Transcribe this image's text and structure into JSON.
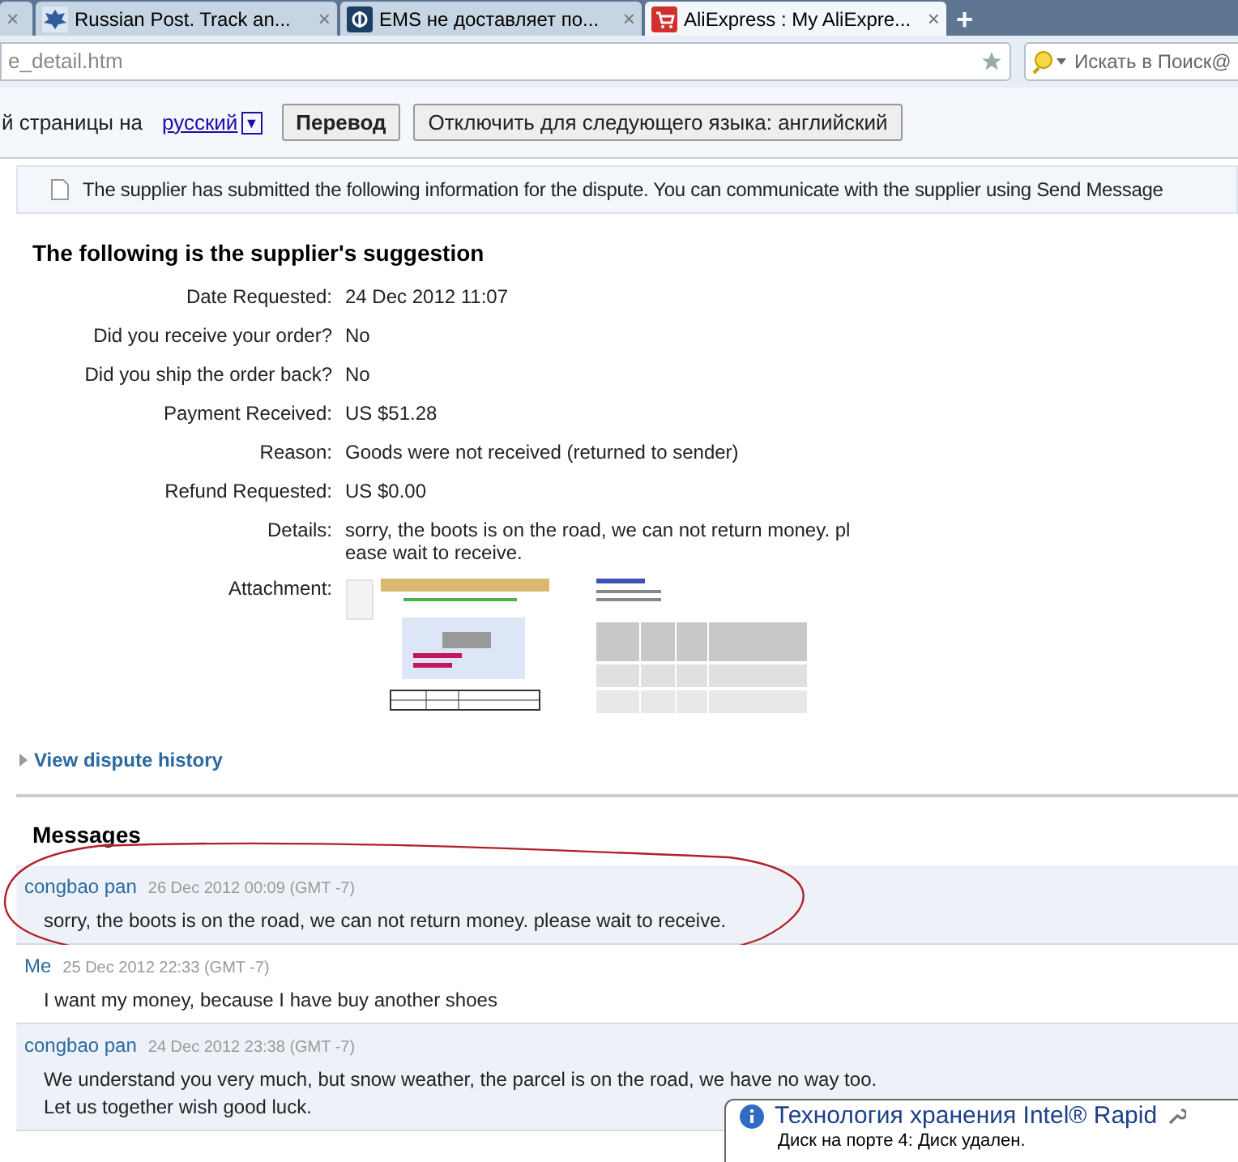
{
  "browser": {
    "tabs": [
      {
        "close": "×",
        "selected": false,
        "kind": "partial"
      },
      {
        "title": "Russian Post. Track an...",
        "close": "×",
        "selected": false,
        "kind": "post"
      },
      {
        "title": "EMS не доставляет по...",
        "close": "×",
        "selected": false,
        "kind": "ems"
      },
      {
        "title": "AliExpress : My AliExpre...",
        "close": "×",
        "selected": true,
        "kind": "cart"
      }
    ],
    "new_tab": "+",
    "address": "e_detail.htm",
    "search_placeholder": "Искать в Поиск@"
  },
  "translate_bar": {
    "prefix": "й страницы на",
    "language": "русский",
    "dropdown": "▼",
    "translate_button": "Перевод",
    "disable_button": "Отключить для следующего языка: английский"
  },
  "notice": "The supplier has submitted the following information for the dispute. You can communicate with the supplier using Send Message",
  "suggestion": {
    "title": "The following is the supplier's suggestion",
    "fields": [
      {
        "label": "Date Requested:",
        "value": "24 Dec 2012 11:07"
      },
      {
        "label": "Did you receive your order?",
        "value": "No"
      },
      {
        "label": "Did you ship the order back?",
        "value": "No"
      },
      {
        "label": "Payment Received:",
        "value": "US $51.28"
      },
      {
        "label": "Reason:",
        "value": "Goods were not received (returned to sender)"
      },
      {
        "label": "Refund Requested:",
        "value": "US $0.00"
      },
      {
        "label": "Details:",
        "value": "sorry, the boots is on the road, we can not return money. pl\nease wait to receive."
      }
    ],
    "attachment_label": "Attachment:",
    "attachments": [
      {
        "kind": "form"
      },
      {
        "kind": "table"
      }
    ]
  },
  "history_link": "View dispute history",
  "messages_title": "Messages",
  "messages": [
    {
      "author": "congbao pan",
      "date": "26 Dec 2012 00:09 (GMT -7)",
      "text": "sorry, the boots is on the road, we can not return money. please wait to receive.",
      "shaded": true,
      "circled": true
    },
    {
      "author": "Me",
      "date": "25 Dec 2012 22:33 (GMT -7)",
      "text": "I want my money, because I have buy another shoes",
      "shaded": false,
      "circled": false
    },
    {
      "author": "congbao pan",
      "date": "24 Dec 2012 23:38 (GMT -7)",
      "text": "We understand you very much, but snow weather, the parcel is on the road, we have no way too.\nLet us together wish good luck.",
      "shaded": true,
      "circled": false
    }
  ],
  "notification": {
    "title": "Технология хранения Intel® Rapid",
    "text": "Диск на порте 4: Диск удален."
  }
}
